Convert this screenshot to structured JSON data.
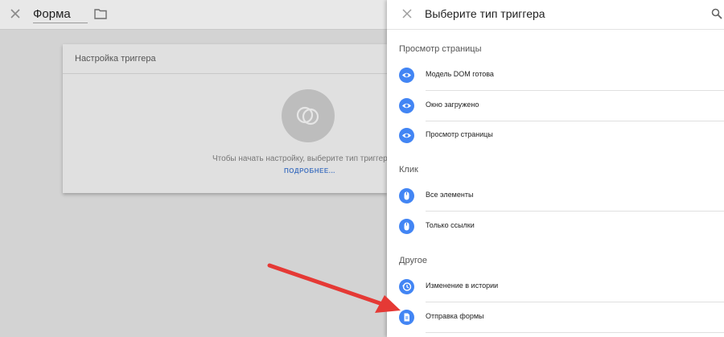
{
  "editor": {
    "title": "Форма",
    "card_header": "Настройка триггера",
    "hint": "Чтобы начать настройку, выберите тип триггера",
    "more_link": "ПОДРОБНЕЕ..."
  },
  "panel": {
    "title": "Выберите тип триггера",
    "sections": [
      {
        "title": "Просмотр страницы",
        "items": [
          {
            "label": "Модель DOM готова",
            "icon": "eye-icon"
          },
          {
            "label": "Окно загружено",
            "icon": "eye-icon"
          },
          {
            "label": "Просмотр страницы",
            "icon": "eye-icon"
          }
        ]
      },
      {
        "title": "Клик",
        "items": [
          {
            "label": "Все элементы",
            "icon": "mouse-icon"
          },
          {
            "label": "Только ссылки",
            "icon": "mouse-icon"
          }
        ]
      },
      {
        "title": "Другое",
        "items": [
          {
            "label": "Изменение в истории",
            "icon": "history-icon"
          },
          {
            "label": "Отправка формы",
            "icon": "form-document-icon"
          }
        ]
      }
    ]
  },
  "colors": {
    "accent": "#4285f4",
    "arrow": "#e53935",
    "overlay": "#d3d3d3"
  }
}
